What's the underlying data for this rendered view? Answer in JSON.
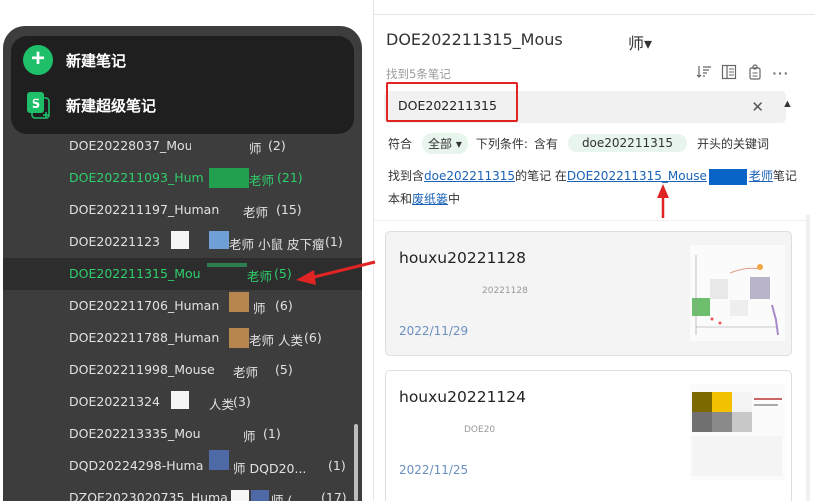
{
  "sidebar": {
    "new_note_label": "新建笔记",
    "new_super_note_label": "新建超级笔记",
    "notes": [
      {
        "prefix": "DOE20228037_Mous",
        "suffix": "师",
        "count": "(2)"
      },
      {
        "prefix": "DOE202211093_Hum",
        "suffix": "老师",
        "count": "(21)"
      },
      {
        "prefix": "DOE202211197_Human",
        "suffix": "老师",
        "count": "(15)"
      },
      {
        "prefix": "DOE20221123",
        "suffix": "老师 小鼠 皮下瘤",
        "count": "(1)"
      },
      {
        "prefix": "DOE202211315_Mou",
        "suffix": "老师",
        "count": "(5)"
      },
      {
        "prefix": "DOE202211706_Human",
        "suffix": "师",
        "count": "(6)"
      },
      {
        "prefix": "DOE202211788_Human",
        "suffix": "老师 人类",
        "count": "(6)"
      },
      {
        "prefix": "DOE202211998_Mouse",
        "suffix": "老师",
        "count": "(5)"
      },
      {
        "prefix": "DOE20221324",
        "suffix": "人类",
        "count": "(3)"
      },
      {
        "prefix": "DOE202213335_Mou",
        "suffix": "师",
        "count": "(1)"
      },
      {
        "prefix": "DQD20224298-Huma",
        "suffix": "师 DQD20...",
        "count": "(1)"
      },
      {
        "prefix": "DZOE2023020735_Huma",
        "suffix": "师 (...",
        "count": "(17)"
      }
    ]
  },
  "notebook": {
    "title": "DOE202211315_Mous",
    "title_suffix": "师▾",
    "found_count": "找到5条笔记"
  },
  "search": {
    "query": "DOE202211315"
  },
  "filter": {
    "match_label": "符合",
    "scope_selected": "全部",
    "conditions_label": "下列条件:",
    "contains_label": "含有",
    "keyword": "doe202211315",
    "suffix_label": "开头的关键词"
  },
  "result": {
    "part1": "找到含",
    "keyword_link": "doe202211315",
    "part2": "的笔记 在",
    "notebook_link": "DOE202211315_Mouse",
    "notebook_link_tail": "老师",
    "part3": "笔记本和",
    "trash_link": "废纸篓",
    "part4": "中"
  },
  "cards": [
    {
      "title": "houxu20221128",
      "snippet": "20221128",
      "date": "2022/11/29"
    },
    {
      "title": "houxu20221124",
      "snippet": "DOE20",
      "date": "2022/11/25"
    }
  ],
  "icons": {
    "sort": "sort-icon",
    "view": "view-toggle-icon",
    "share": "share-icon",
    "more": "more-icon",
    "clear": "close-icon",
    "collapse": "chevron-up-icon"
  },
  "colors": {
    "accent_green": "#2ecf6c",
    "new_button_green": "#1fbf6a",
    "sidebar_bg": "#3d3d3d",
    "annotation_red": "#e02424",
    "link_blue": "#1a62b8"
  }
}
